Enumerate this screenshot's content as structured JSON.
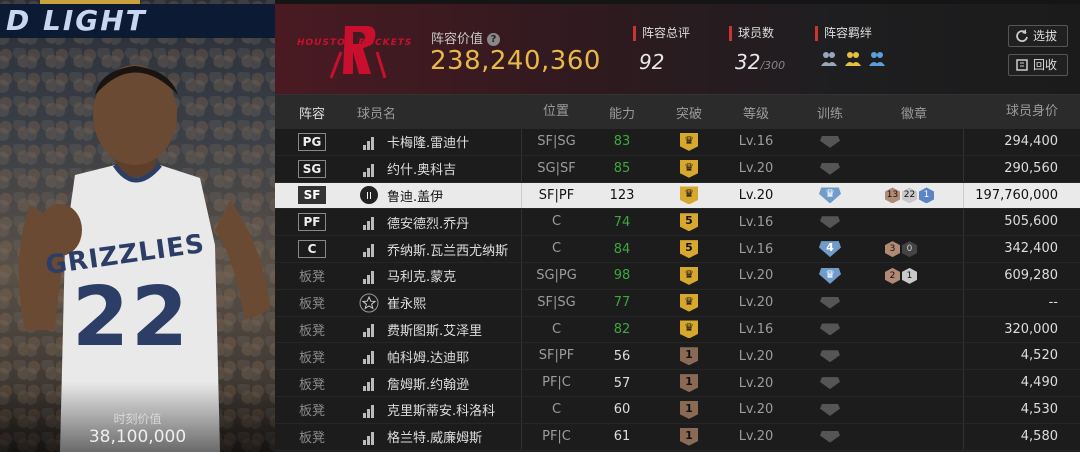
{
  "player_panel": {
    "banner_text": "D LIGHT",
    "jersey_team": "GRIZZLIES",
    "jersey_number": "22",
    "value_label": "时刻价值",
    "value": "38,100,000"
  },
  "header": {
    "team_logo_text": "HOUSTON ROCKETS",
    "lineup_value_label": "阵容价值",
    "lineup_value": "238,240,360",
    "stats": {
      "overall_label": "阵容总评",
      "overall_value": "92",
      "players_label": "球员数",
      "players_value": "32",
      "players_max": "/300",
      "chemistry_label": "阵容羁绊"
    },
    "buttons": {
      "select": "选拔",
      "recycle": "回收"
    }
  },
  "table": {
    "columns": [
      "阵容",
      "球员名",
      "位置",
      "能力",
      "突破",
      "等级",
      "训练",
      "徽章",
      "球员身价"
    ],
    "rows": [
      {
        "slot": "PG",
        "name": "卡梅隆.雷迪什",
        "pos": "SF|SG",
        "ability": "83",
        "break": "crown",
        "level": "Lv.16",
        "train": "",
        "badges": [],
        "value": "294,400"
      },
      {
        "slot": "SG",
        "name": "约什.奥科吉",
        "pos": "SG|SF",
        "ability": "85",
        "break": "crown",
        "level": "Lv.20",
        "train": "",
        "badges": [],
        "value": "290,560"
      },
      {
        "slot": "SF",
        "name": "鲁迪.盖伊",
        "pos": "SF|PF",
        "ability": "123",
        "break": "crown",
        "level": "Lv.20",
        "train": "crown",
        "badges": [
          "13",
          "22",
          "1"
        ],
        "value": "197,760,000"
      },
      {
        "slot": "PF",
        "name": "德安德烈.乔丹",
        "pos": "C",
        "ability": "74",
        "break": "5",
        "level": "Lv.16",
        "train": "",
        "badges": [],
        "value": "505,600"
      },
      {
        "slot": "C",
        "name": "乔纳斯.瓦兰西尤纳斯",
        "pos": "C",
        "ability": "84",
        "break": "5",
        "level": "Lv.16",
        "train": "4",
        "badges": [
          "3",
          "0"
        ],
        "value": "342,400"
      },
      {
        "slot": "板凳",
        "name": "马利克.蒙克",
        "pos": "SG|PG",
        "ability": "98",
        "break": "crown",
        "level": "Lv.20",
        "train": "crown",
        "badges": [
          "2",
          "1"
        ],
        "value": "609,280"
      },
      {
        "slot": "板凳",
        "name": "崔永熙",
        "pos": "SF|SG",
        "ability": "77",
        "break": "crown",
        "level": "Lv.20",
        "train": "",
        "badges": [],
        "value": "--"
      },
      {
        "slot": "板凳",
        "name": "费斯图斯.艾泽里",
        "pos": "C",
        "ability": "82",
        "break": "crown",
        "level": "Lv.16",
        "train": "",
        "badges": [],
        "value": "320,000"
      },
      {
        "slot": "板凳",
        "name": "帕科姆.达迪耶",
        "pos": "SF|PF",
        "ability": "56",
        "break": "1",
        "level": "Lv.20",
        "train": "",
        "badges": [],
        "value": "4,520"
      },
      {
        "slot": "板凳",
        "name": "詹姆斯.约翰逊",
        "pos": "PF|C",
        "ability": "57",
        "break": "1",
        "level": "Lv.20",
        "train": "",
        "badges": [],
        "value": "4,490"
      },
      {
        "slot": "板凳",
        "name": "克里斯蒂安.科洛科",
        "pos": "C",
        "ability": "60",
        "break": "1",
        "level": "Lv.20",
        "train": "",
        "badges": [],
        "value": "4,530"
      },
      {
        "slot": "板凳",
        "name": "格兰特.威廉姆斯",
        "pos": "PF|C",
        "ability": "61",
        "break": "1",
        "level": "Lv.20",
        "train": "",
        "badges": [],
        "value": "4,580"
      }
    ]
  },
  "colors": {
    "gold": "#e8b849",
    "accent_red": "#cc3333",
    "ability_green": "#3ea63e"
  }
}
